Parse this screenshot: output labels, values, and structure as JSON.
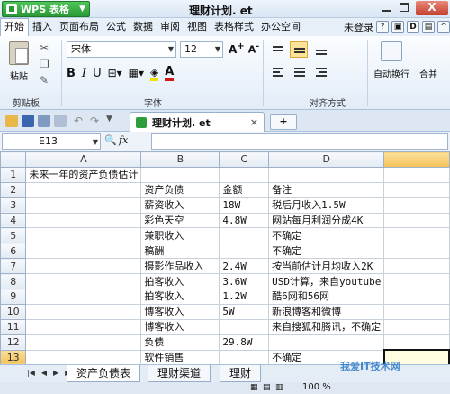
{
  "app": {
    "brand": "WPS 表格",
    "doc_title": "理财计划. et",
    "close_glyph": "X"
  },
  "menu": {
    "items": [
      "开始",
      "插入",
      "页面布局",
      "公式",
      "数据",
      "审阅",
      "视图",
      "表格样式",
      "办公空间"
    ],
    "login": "未登录"
  },
  "ribbon": {
    "paste_label": "粘贴",
    "clipboard_group": "剪贴板",
    "font_name": "宋体",
    "font_size": "12",
    "font_group": "字体",
    "align_group": "对齐方式",
    "wrap_label": "自动换行",
    "merge_label": "合并"
  },
  "tabs": {
    "doc_tab": "理财计划. et",
    "new_tab": "+"
  },
  "formula": {
    "cell_ref": "E13",
    "fx": "fx",
    "content": ""
  },
  "sheet": {
    "columns": [
      "A",
      "B",
      "C",
      "D"
    ],
    "rows": [
      {
        "n": "1",
        "a": "未来一年的资产负债估计",
        "b": "",
        "c": "",
        "d": ""
      },
      {
        "n": "2",
        "a": "",
        "b": "资产负债",
        "c": "金额",
        "d": "备注"
      },
      {
        "n": "3",
        "a": "",
        "b": "薪资收入",
        "c": "18W",
        "d": "税后月收入1.5W"
      },
      {
        "n": "4",
        "a": "",
        "b": "彩色天空",
        "c": "4.8W",
        "d": "网站每月利润分成4K"
      },
      {
        "n": "5",
        "a": "",
        "b": "兼职收入",
        "c": "",
        "d": "不确定"
      },
      {
        "n": "6",
        "a": "",
        "b": "稿酬",
        "c": "",
        "d": "不确定"
      },
      {
        "n": "7",
        "a": "",
        "b": "摄影作品收入",
        "c": "2.4W",
        "d": "按当前估计月均收入2K"
      },
      {
        "n": "8",
        "a": "",
        "b": "拍客收入",
        "c": "3.6W",
        "d": "USD计算，来自youtube"
      },
      {
        "n": "9",
        "a": "",
        "b": "拍客收入",
        "c": "1.2W",
        "d": "酷6网和56网"
      },
      {
        "n": "10",
        "a": "",
        "b": "博客收入",
        "c": "5W",
        "d": "新浪博客和微博"
      },
      {
        "n": "11",
        "a": "",
        "b": "博客收入",
        "c": "",
        "d": "来自搜狐和腾讯，不确定"
      },
      {
        "n": "12",
        "a": "",
        "b": "负债",
        "c": "29.8W",
        "d": ""
      },
      {
        "n": "13",
        "a": "",
        "b": "软件销售",
        "c": "",
        "d": "不确定"
      }
    ]
  },
  "sheet_tabs": [
    "资产负债表",
    "理财渠道",
    "理财"
  ],
  "status": {
    "zoom": "100 %"
  },
  "watermark": "我爱IT技术网"
}
